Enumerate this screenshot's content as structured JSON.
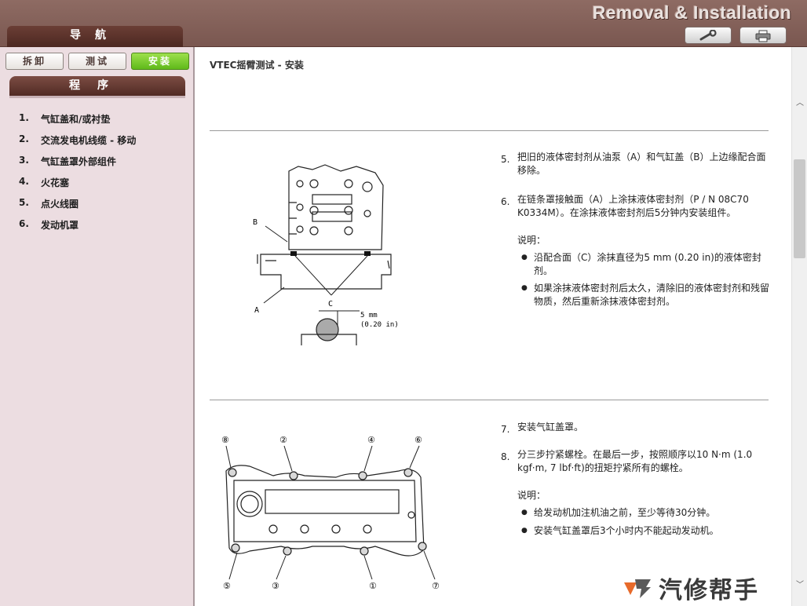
{
  "header": {
    "app_title": "Removal & Installation",
    "nav_label": "导航"
  },
  "sidebar": {
    "tabs": [
      {
        "label": "拆卸",
        "active": false
      },
      {
        "label": "测试",
        "active": false
      },
      {
        "label": "安装",
        "active": true
      }
    ],
    "procedure_header": "程序",
    "items": [
      {
        "num": "1.",
        "label": "气缸盖和/或衬垫"
      },
      {
        "num": "2.",
        "label": "交流发电机线缆 - 移动"
      },
      {
        "num": "3.",
        "label": "气缸盖罩外部组件"
      },
      {
        "num": "4.",
        "label": "火花塞"
      },
      {
        "num": "5.",
        "label": "点火线圈"
      },
      {
        "num": "6.",
        "label": "发动机罩"
      }
    ]
  },
  "main": {
    "title": "VTEC摇臂测试 - 安装",
    "steps_a": [
      {
        "num": "5.",
        "text": "把旧的液体密封剂从油泵（A）和气缸盖（B）上边缘配合面移除。"
      },
      {
        "num": "6.",
        "text": "在链条罩接触面（A）上涂抹液体密封剂（P / N 08C70 K0334M）。在涂抹液体密封剂后5分钟内安装组件。"
      }
    ],
    "note_a_label": "说明：",
    "note_a": [
      "沿配合面（C）涂抹直径为5 mm (0.20 in)的液体密封剂。",
      "如果涂抹液体密封剂后太久，清除旧的液体密封剂和残留物质，然后重新涂抹液体密封剂。"
    ],
    "fig1_labels": {
      "a": "A",
      "b": "B",
      "c": "C",
      "dim_mm": "5 mm",
      "dim_in": "(0.20 in)"
    },
    "steps_b": [
      {
        "num": "7.",
        "text": "安装气缸盖罩。"
      },
      {
        "num": "8.",
        "text": "分三步拧紧螺栓。在最后一步，按照顺序以10 N·m (1.0 kgf·m, 7 lbf·ft)的扭矩拧紧所有的螺栓。"
      }
    ],
    "note_b_label": "说明：",
    "note_b": [
      "给发动机加注机油之前，至少等待30分钟。",
      "安装气缸盖罩后3个小时内不能起动发动机。"
    ],
    "fig2_bolts": [
      "⑧",
      "②",
      "④",
      "⑥",
      "⑤",
      "③",
      "①",
      "⑦"
    ]
  },
  "watermark": {
    "text": "汽修帮手"
  },
  "icons": {
    "wrench": "wrench-icon",
    "print": "printer-icon"
  },
  "colors": {
    "header": "#7a5750",
    "sidebar": "#ecdde1",
    "active_tab": "#6cc022"
  }
}
